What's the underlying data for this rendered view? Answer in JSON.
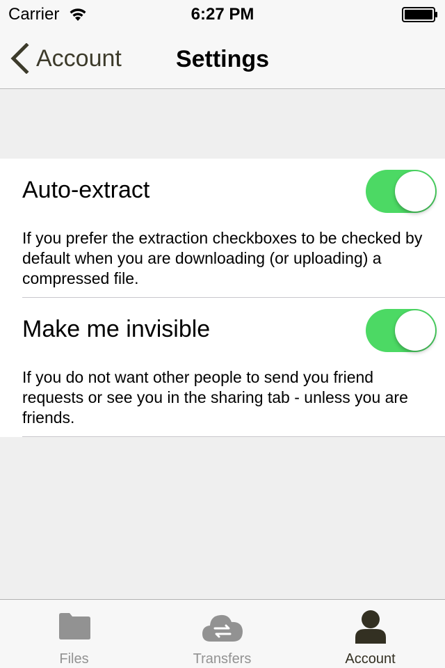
{
  "status_bar": {
    "carrier": "Carrier",
    "time": "6:27 PM"
  },
  "nav": {
    "back_label": "Account",
    "title": "Settings"
  },
  "settings": [
    {
      "title": "Auto-extract",
      "description": "If you prefer the extraction checkboxes to be checked by default when you are downloading (or uploading) a compressed file.",
      "enabled": true
    },
    {
      "title": "Make me invisible",
      "description": "If you do not want other people to send you friend requests or see you in the sharing tab - unless you are friends.",
      "enabled": true
    }
  ],
  "tabs": [
    {
      "label": "Files",
      "icon": "folder-icon",
      "active": false
    },
    {
      "label": "Transfers",
      "icon": "cloud-transfer-icon",
      "active": false
    },
    {
      "label": "Account",
      "icon": "person-icon",
      "active": true
    }
  ],
  "colors": {
    "toggle_on": "#4cd964",
    "active_tab": "#333022",
    "inactive_tab": "#929292",
    "back_accent": "#3d3b2b"
  }
}
